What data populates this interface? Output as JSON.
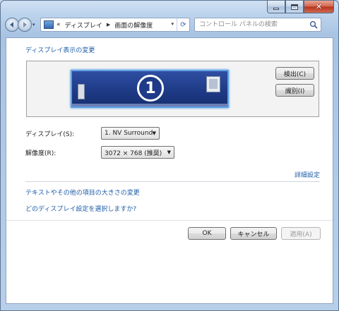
{
  "nav": {
    "breadcrumb": [
      "ディスプレイ",
      "画面の解像度"
    ],
    "overflow_chevron": "«",
    "search_placeholder": "コントロール パネルの検索"
  },
  "main": {
    "title_link": "ディスプレイ表示の変更",
    "monitor_number": "1",
    "detect_button": "検出(C)",
    "identify_button": "識別(I)",
    "display_label": "ディスプレイ(S):",
    "display_value": "1. NV Surround",
    "resolution_label": "解像度(R):",
    "resolution_value": "3072 × 768 (推奨)",
    "advanced_link": "詳細設定",
    "text_size_link": "テキストやその他の項目の大きさの変更",
    "help_link": "どのディスプレイ設定を選択しますか?"
  },
  "footer": {
    "ok_button": "OK",
    "cancel_button": "キャンセル",
    "apply_button": "適用(A)"
  },
  "icons": {
    "back": "back-arrow-icon",
    "forward": "forward-arrow-icon",
    "address": "control-panel-icon",
    "refresh": "refresh-icon",
    "search": "search-icon",
    "minimize": "minimize-icon",
    "maximize": "maximize-icon",
    "close": "close-icon"
  },
  "colors": {
    "link": "#1e5ca8",
    "monitor": "#1e3a88",
    "close_button": "#c8452c"
  }
}
